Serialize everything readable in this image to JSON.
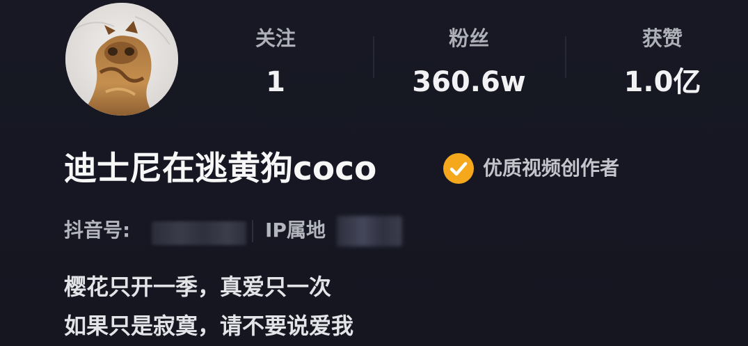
{
  "profile": {
    "name": "迪士尼在逃黄狗coco",
    "avatar_icon": "dog-avatar-photo",
    "badge": {
      "icon": "check-circle-icon",
      "color": "#f5a81c",
      "text": "优质视频创作者"
    },
    "douyin_id_label": "抖音号:",
    "ip_label": "IP属地",
    "bio": [
      "樱花只开一季，真爱只一次",
      "如果只是寂寞，请不要说爱我"
    ]
  },
  "stats": {
    "following": {
      "label": "关注",
      "value": "1"
    },
    "followers": {
      "label": "粉丝",
      "value": "360.6w"
    },
    "likes": {
      "label": "获赞",
      "value": "1.0亿"
    }
  },
  "theme": {
    "background": "#161722",
    "text_primary": "#f7f7f8",
    "text_secondary": "#b4b6bd"
  }
}
